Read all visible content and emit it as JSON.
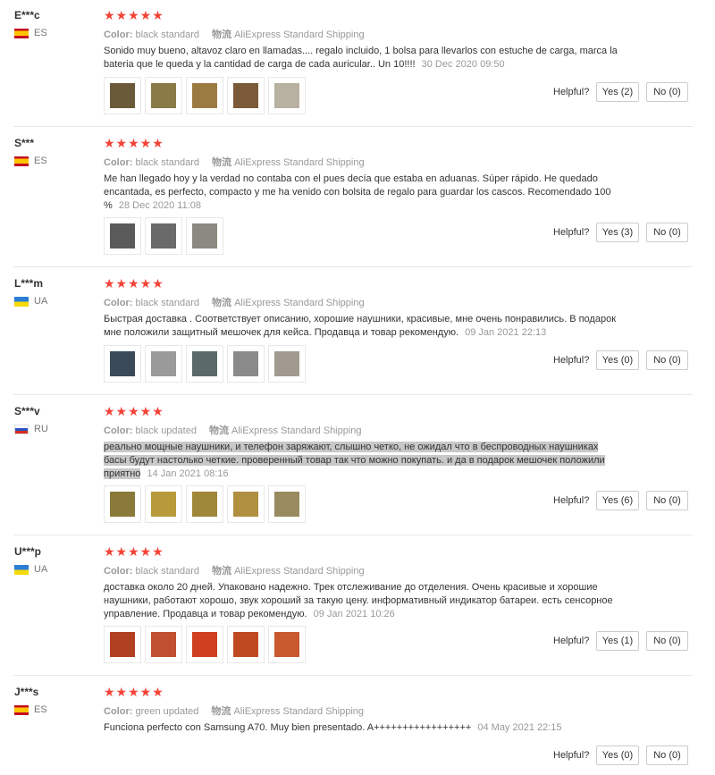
{
  "labels": {
    "color": "Color:",
    "shipping_label": "物流",
    "helpful": "Helpful?"
  },
  "reviews": [
    {
      "user": "E***c",
      "country": "ES",
      "stars": "★★★★★",
      "color": "black standard",
      "shipping": "AliExpress Standard Shipping",
      "text": "Sonido muy bueno, altavoz claro en llamadas.... regalo incluido, 1 bolsa para llevarlos con estuche de carga, marca la bateria que le queda y la cantidad de carga de cada auricular.. Un 10!!!!",
      "date": "30 Dec 2020 09:50",
      "yes": "Yes (2)",
      "no": "No (0)",
      "photo_colors": [
        "#6b5a3a",
        "#8a7a45",
        "#9c7b43",
        "#7a5a38",
        "#b8b0a0"
      ]
    },
    {
      "user": "S***",
      "country": "ES",
      "stars": "★★★★★",
      "color": "black standard",
      "shipping": "AliExpress Standard Shipping",
      "text": "Me han llegado hoy y la verdad no contaba con el pues decía que estaba en aduanas. Súper rápido. He quedado encantada, es perfecto, compacto y me ha venido con bolsita de regalo para guardar los cascos. Recomendado 100 %",
      "date": "28 Dec 2020 11:08",
      "yes": "Yes (3)",
      "no": "No (0)",
      "photo_colors": [
        "#5a5a5a",
        "#6a6a6a",
        "#8a8a80"
      ]
    },
    {
      "user": "L***m",
      "country": "UA",
      "stars": "★★★★★",
      "color": "black standard",
      "shipping": "AliExpress Standard Shipping",
      "text": "Быстрая доставка . Соответствует описанию, хорошие наушники, красивые, мне очень понравились. В подарок мне положили защитный мешочек для кейса. Продавца и товар рекомендую.",
      "date": "09 Jan 2021 22:13",
      "yes": "Yes (0)",
      "no": "No (0)",
      "photo_colors": [
        "#3a4a5a",
        "#9a9a9a",
        "#5a6a6a",
        "#8a8a8a",
        "#a09a90"
      ]
    },
    {
      "user": "S***v",
      "country": "RU",
      "stars": "★★★★★",
      "color": "black updated",
      "shipping": "AliExpress Standard Shipping",
      "text": "реально мощные наушники, и телефон заряжают, слышно четко, не ожидал что в беспроводных наушниках басы будут настолько четкие. проверенный товар так что можно покупать. и да в подарок мешочек положили приятно",
      "date": "14 Jan 2021 08:16",
      "yes": "Yes (6)",
      "no": "No (0)",
      "photo_colors": [
        "#8a7a3a",
        "#b89a3a",
        "#a0883a",
        "#b09040",
        "#9a8a60"
      ]
    },
    {
      "user": "U***p",
      "country": "UA",
      "stars": "★★★★★",
      "color": "black standard",
      "shipping": "AliExpress Standard Shipping",
      "text": "доставка около 20 дней. Упаковано надежно. Трек отслеживание до отделения. Очень красивые и хорошие наушники, работают хорошо, звук хороший за такую цену. информативный индикатор батареи. есть сенсорное управление. Продавца и товар рекомендую.",
      "date": "09 Jan 2021 10:26",
      "yes": "Yes (1)",
      "no": "No (0)",
      "photo_colors": [
        "#b04020",
        "#c05030",
        "#d04020",
        "#c04a20",
        "#c85a30"
      ]
    },
    {
      "user": "J***s",
      "country": "ES",
      "stars": "★★★★★",
      "color": "green updated",
      "shipping": "AliExpress Standard Shipping",
      "text": "Funciona perfecto con Samsung A70. Muy bien presentado. A+++++++++++++++++",
      "date": "04 May 2021 22:15",
      "yes": "Yes (0)",
      "no": "No (0)",
      "photo_colors": []
    }
  ]
}
